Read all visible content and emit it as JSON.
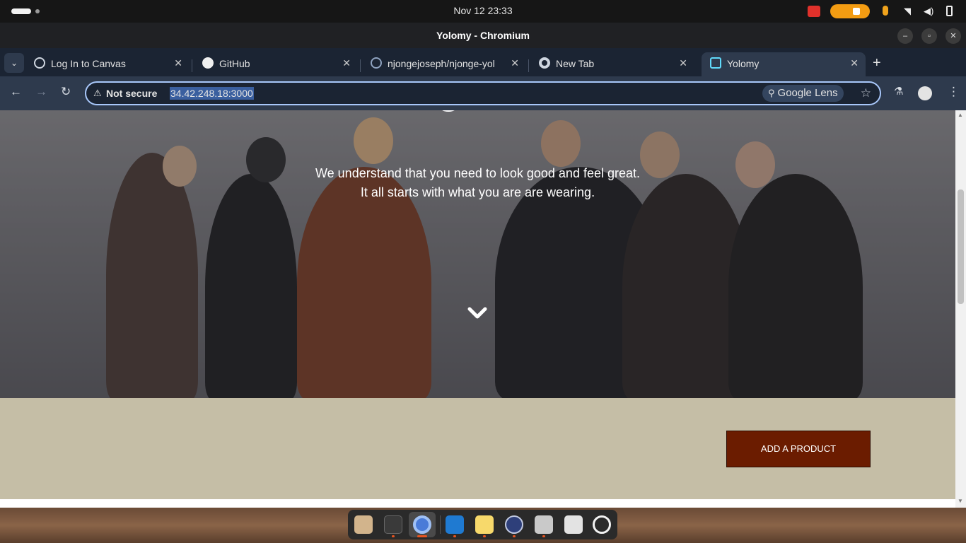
{
  "topbar": {
    "datetime": "Nov 12  23:33",
    "tray_icons": [
      "screencast-icon",
      "screen-share-icon",
      "stop-icon",
      "microphone-icon",
      "wifi-icon",
      "volume-icon",
      "battery-icon"
    ]
  },
  "window": {
    "title": "Yolomy - Chromium",
    "controls": [
      "minimize",
      "maximize",
      "close"
    ]
  },
  "tabs": [
    {
      "label": "Log In to Canvas",
      "icon": "globe-icon",
      "active": false
    },
    {
      "label": "GitHub",
      "icon": "github-icon",
      "active": false
    },
    {
      "label": "njongejoseph/njonge-yol",
      "icon": "repo-icon",
      "active": false
    },
    {
      "label": "New Tab",
      "icon": "chrome-icon",
      "active": false
    },
    {
      "label": "Yolomy",
      "icon": "react-icon",
      "active": true
    }
  ],
  "toolbar": {
    "security_label": "Not secure",
    "url": "34.42.248.18:3000",
    "lens_label": "Google Lens"
  },
  "page": {
    "hero_line1": "We understand that you need to look good and feel great.",
    "hero_line2": "It all starts with what you are are wearing.",
    "add_product_label": "ADD A PRODUCT"
  },
  "colors": {
    "band": "#c5bea6",
    "button": "#6b1c00",
    "omnibox_border": "#a8c7fa"
  },
  "dock": {
    "apps": [
      "files-icon",
      "terminal-icon",
      "chromium-icon",
      "vscode-icon",
      "text-editor-icon",
      "timeshift-icon",
      "image-viewer-icon",
      "trash-icon",
      "ubuntu-icon"
    ]
  }
}
